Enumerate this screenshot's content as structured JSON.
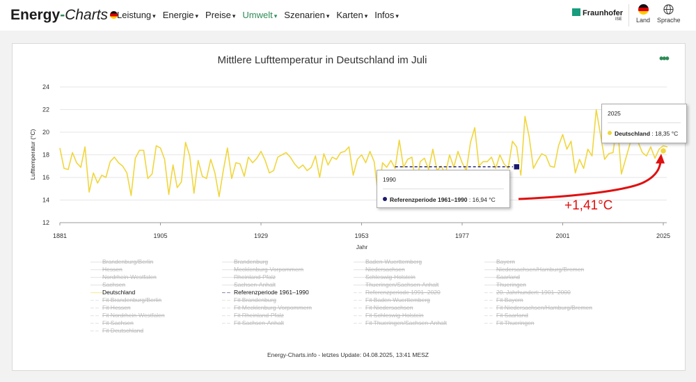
{
  "header": {
    "logo_main": "Energy",
    "logo_dash": "-",
    "logo_italic": "Charts",
    "nav": [
      "Leistung",
      "Energie",
      "Preise",
      "Umwelt",
      "Szenarien",
      "Karten",
      "Infos"
    ],
    "active_nav": "Umwelt",
    "partner": "Fraunhofer",
    "partner_sub": "ISE",
    "land_label": "Land",
    "sprache_label": "Sprache"
  },
  "colors": {
    "accent": "#2e8b57",
    "series": "#f0d63c",
    "reference": "#1a1a6e",
    "annotation": "#e01010"
  },
  "menu_icon": "three-dots-icon",
  "chart_data": {
    "type": "line",
    "title": "Mittlere Lufttemperatur in Deutschland im Juli",
    "ylabel": "Lufttemperatur (°C)",
    "xlabel": "Jahr",
    "ylim": [
      12,
      24
    ],
    "xlim": [
      1881,
      2025
    ],
    "yticks": [
      "12",
      "14",
      "16",
      "18",
      "20",
      "22",
      "24"
    ],
    "xticks": [
      "1881",
      "1905",
      "1929",
      "1953",
      "1977",
      "2001",
      "2025"
    ],
    "grid": true,
    "series": [
      {
        "name": "Deutschland",
        "x_start": 1881,
        "values": [
          18.6,
          16.8,
          16.7,
          18.2,
          17.3,
          16.9,
          18.7,
          14.7,
          16.4,
          15.5,
          16.2,
          16.0,
          17.4,
          17.8,
          17.3,
          17.0,
          16.4,
          14.4,
          17.7,
          18.4,
          18.4,
          15.9,
          16.3,
          18.8,
          18.6,
          17.6,
          14.5,
          17.1,
          15.1,
          15.6,
          19.1,
          17.9,
          14.6,
          17.5,
          16.1,
          15.9,
          17.6,
          16.4,
          14.3,
          16.6,
          18.6,
          15.9,
          17.3,
          17.2,
          16.1,
          17.8,
          17.3,
          17.7,
          18.3,
          17.5,
          16.4,
          16.6,
          17.8,
          18.0,
          18.2,
          17.8,
          17.2,
          16.8,
          17.1,
          16.6,
          16.9,
          17.9,
          16.0,
          18.1,
          17.1,
          17.8,
          17.6,
          18.2,
          18.3,
          18.7,
          16.2,
          17.6,
          18.0,
          17.3,
          18.3,
          17.4,
          14.3,
          17.3,
          16.9,
          17.5,
          16.8,
          19.3,
          16.9,
          17.6,
          17.8,
          15.2,
          17.4,
          17.7,
          16.7,
          18.5,
          16.6,
          17.0,
          16.3,
          18.0,
          16.9,
          18.3,
          17.3,
          16.6,
          19.1,
          20.4,
          17.0,
          17.4,
          17.4,
          17.8,
          16.8,
          18.0,
          17.2,
          16.8,
          19.2,
          18.7,
          16.2,
          21.4,
          19.6,
          16.8,
          17.5,
          18.1,
          17.9,
          17.0,
          16.9,
          18.8,
          19.8,
          18.5,
          19.2,
          16.4,
          17.6,
          16.8,
          18.5,
          17.9,
          22.0,
          19.8,
          17.6,
          18.1,
          18.2,
          20.9,
          16.3,
          17.6,
          18.9,
          20.7,
          19.1,
          18.2,
          17.9,
          18.7,
          17.7,
          18.5,
          18.8,
          18.7
        ],
        "final_value": 18.35
      },
      {
        "name": "Referenzperiode 1961–1990",
        "x_range": [
          1961,
          1990
        ],
        "value": 16.94
      }
    ],
    "tooltips": [
      {
        "year": "1990",
        "series": "Referenzperiode 1961–1990",
        "value_text": "16,94 °C"
      },
      {
        "year": "2025",
        "series": "Deutschland",
        "value_text": "18,35 °C"
      }
    ],
    "annotation": "+1,41°C"
  },
  "legend": {
    "col1": [
      {
        "label": "Brandenburg/Berlin",
        "on": false,
        "sym": "solid"
      },
      {
        "label": "Hessen",
        "on": false,
        "sym": "solid"
      },
      {
        "label": "Nordrhein-Westfalen",
        "on": false,
        "sym": "solid"
      },
      {
        "label": "Sachsen",
        "on": false,
        "sym": "solid"
      },
      {
        "label": "Deutschland",
        "on": true,
        "sym": "solid"
      },
      {
        "label": "Fit Brandenburg/Berlin",
        "on": false,
        "sym": "dash"
      },
      {
        "label": "Fit Hessen",
        "on": false,
        "sym": "dash"
      },
      {
        "label": "Fit Nordrhein-Westfalen",
        "on": false,
        "sym": "dash"
      },
      {
        "label": "Fit Sachsen",
        "on": false,
        "sym": "dash"
      },
      {
        "label": "Fit Deutschland",
        "on": false,
        "sym": "dash"
      }
    ],
    "col2": [
      {
        "label": "Brandenburg",
        "on": false,
        "sym": "solid"
      },
      {
        "label": "Mecklenburg-Vorpommern",
        "on": false,
        "sym": "solid"
      },
      {
        "label": "Rheinland-Pfalz",
        "on": false,
        "sym": "solid"
      },
      {
        "label": "Sachsen-Anhalt",
        "on": false,
        "sym": "solid"
      },
      {
        "label": "Referenzperiode 1961–1990",
        "on": true,
        "sym": "dash"
      },
      {
        "label": "Fit Brandenburg",
        "on": false,
        "sym": "dash"
      },
      {
        "label": "Fit Mecklenburg-Vorpommern",
        "on": false,
        "sym": "dash"
      },
      {
        "label": "Fit Rheinland-Pfalz",
        "on": false,
        "sym": "dash"
      },
      {
        "label": "Fit Sachsen-Anhalt",
        "on": false,
        "sym": "dash"
      }
    ],
    "col3": [
      {
        "label": "Baden-Wuerttemberg",
        "on": false,
        "sym": "solid"
      },
      {
        "label": "Niedersachsen",
        "on": false,
        "sym": "solid"
      },
      {
        "label": "Schleswig-Holstein",
        "on": false,
        "sym": "solid"
      },
      {
        "label": "Thueringen/Sachsen-Anhalt",
        "on": false,
        "sym": "solid"
      },
      {
        "label": "Referenzperiode 1991–2020",
        "on": false,
        "sym": "dash"
      },
      {
        "label": "Fit Baden-Wuerttemberg",
        "on": false,
        "sym": "dash"
      },
      {
        "label": "Fit Niedersachsen",
        "on": false,
        "sym": "dash"
      },
      {
        "label": "Fit Schleswig-Holstein",
        "on": false,
        "sym": "dash"
      },
      {
        "label": "Fit Thueringen/Sachsen-Anhalt",
        "on": false,
        "sym": "dash"
      }
    ],
    "col4": [
      {
        "label": "Bayern",
        "on": false,
        "sym": "solid"
      },
      {
        "label": "Niedersachsen/Hamburg/Bremen",
        "on": false,
        "sym": "solid"
      },
      {
        "label": "Saarland",
        "on": false,
        "sym": "solid"
      },
      {
        "label": "Thueringen",
        "on": false,
        "sym": "solid"
      },
      {
        "label": "20. Jahrhundert: 1901–2000",
        "on": false,
        "sym": "dash"
      },
      {
        "label": "Fit Bayern",
        "on": false,
        "sym": "dash"
      },
      {
        "label": "Fit Niedersachsen/Hamburg/Bremen",
        "on": false,
        "sym": "dash"
      },
      {
        "label": "Fit Saarland",
        "on": false,
        "sym": "dash"
      },
      {
        "label": "Fit Thueringen",
        "on": false,
        "sym": "dash"
      }
    ]
  },
  "footer": "Energy-Charts.info - letztes Update: 04.08.2025, 13:41 MESZ"
}
